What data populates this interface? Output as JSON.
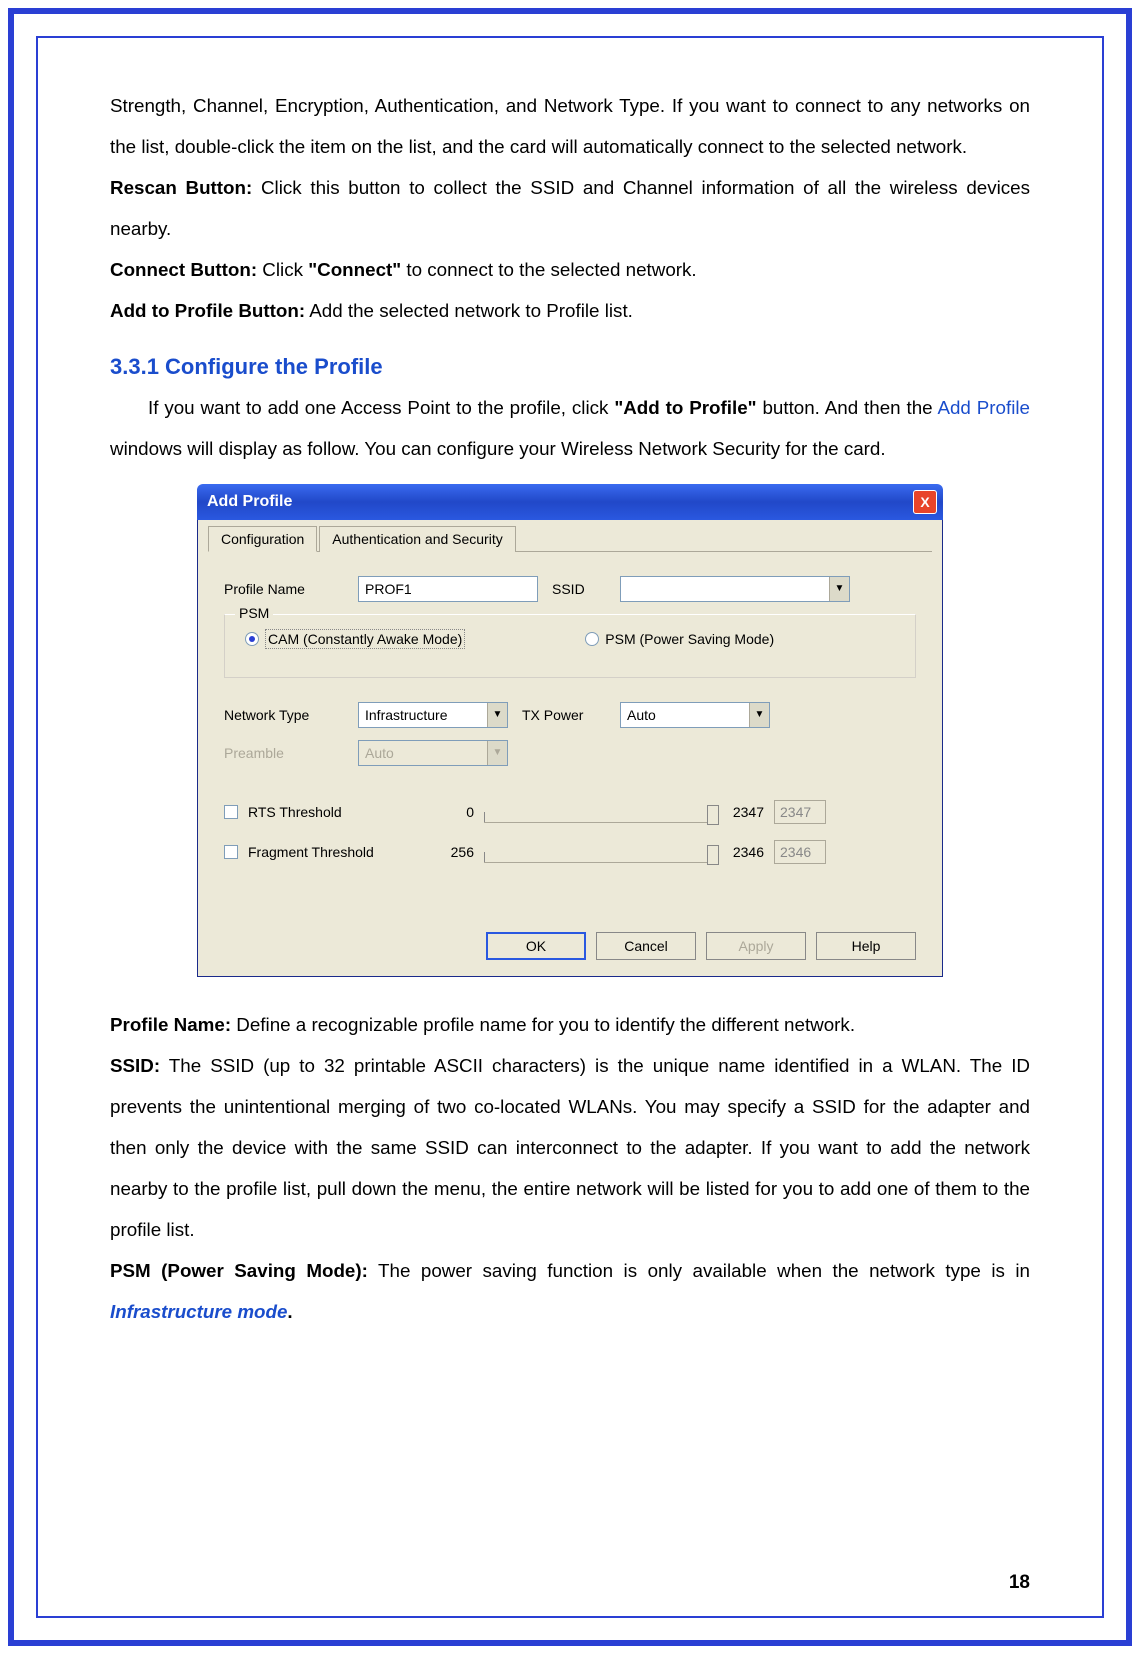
{
  "page_number": "18",
  "intro": {
    "p1": "Strength, Channel, Encryption, Authentication, and Network Type. If you want to connect to any networks on the list, double-click the item on the list, and the card will automatically connect to the selected network.",
    "rescan_label": "Rescan Button:",
    "rescan_text": " Click this button to collect the SSID and Channel information of all the wireless devices nearby.",
    "connect_label": "Connect Button:",
    "connect_text_pre": " Click ",
    "connect_bold": "\"Connect\"",
    "connect_text_post": " to connect to the selected network.",
    "addprofile_label": "Add to Profile Button:",
    "addprofile_text": " Add the selected network to Profile list."
  },
  "heading": "3.3.1 Configure the Profile",
  "section": {
    "p2_pre": "If you want to add one Access Point to the profile, click ",
    "p2_bold": "\"Add to Profile\"",
    "p2_post": " button. And then the ",
    "p2_link": "Add Profile",
    "p2_tail": " windows will display as follow. You can configure your Wireless Network Security for the card."
  },
  "dialog": {
    "title": "Add Profile",
    "close": "X",
    "tabs": [
      "Configuration",
      "Authentication and Security"
    ],
    "profile_name_label": "Profile Name",
    "profile_name_value": "PROF1",
    "ssid_label": "SSID",
    "ssid_value": "",
    "psm_legend": "PSM",
    "psm_opt1": "CAM (Constantly Awake Mode)",
    "psm_opt2": "PSM (Power Saving Mode)",
    "network_type_label": "Network Type",
    "network_type_value": "Infrastructure",
    "tx_power_label": "TX Power",
    "tx_power_value": "Auto",
    "preamble_label": "Preamble",
    "preamble_value": "Auto",
    "rts_label": "RTS Threshold",
    "rts_min": "0",
    "rts_max": "2347",
    "rts_value": "2347",
    "frag_label": "Fragment Threshold",
    "frag_min": "256",
    "frag_max": "2346",
    "frag_value": "2346",
    "btn_ok": "OK",
    "btn_cancel": "Cancel",
    "btn_apply": "Apply",
    "btn_help": "Help"
  },
  "post": {
    "pn_label": "Profile Name:",
    "pn_text": " Define a recognizable profile name for you to identify the different network.",
    "ssid_label": "SSID:",
    "ssid_text": " The SSID (up to 32 printable ASCII characters) is the unique name identified in a WLAN. The ID prevents the unintentional merging of two co-located WLANs. You may specify a SSID for the adapter and then only the device with the same SSID can interconnect to the adapter. If you want to add the network nearby to the profile list, pull down the menu, the entire network will be listed for you to add one of them to the profile list.",
    "psm_label": "PSM (Power Saving Mode):",
    "psm_text_pre": " The power saving function is only available when the network type is in ",
    "psm_italic": "Infrastructure mode",
    "psm_text_post": "."
  }
}
